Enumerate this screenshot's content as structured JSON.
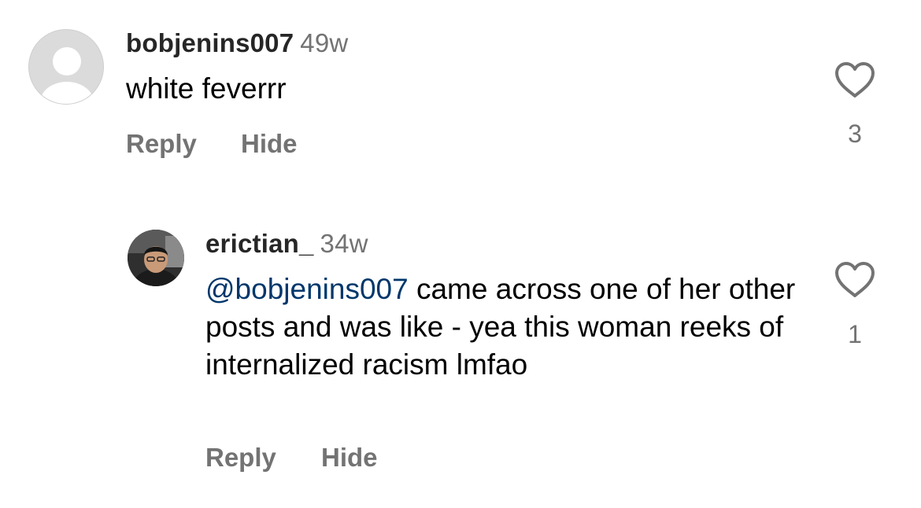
{
  "comments": [
    {
      "username": "bobjenins007",
      "time": "49w",
      "text": "white feverrr",
      "reply_label": "Reply",
      "hide_label": "Hide",
      "likes": "3",
      "avatar": "default-person-icon"
    },
    {
      "username": "erictian_",
      "time": "34w",
      "mention": "@bobjenins007",
      "text": " came across one of her other posts and was like - yea this woman reeks of internalized racism lmfao",
      "reply_label": "Reply",
      "hide_label": "Hide",
      "likes": "1",
      "avatar": "profile-photo"
    }
  ],
  "colors": {
    "username": "#262626",
    "meta": "#737373",
    "mention": "#00376b",
    "avatar_placeholder": "#dbdbdb"
  }
}
